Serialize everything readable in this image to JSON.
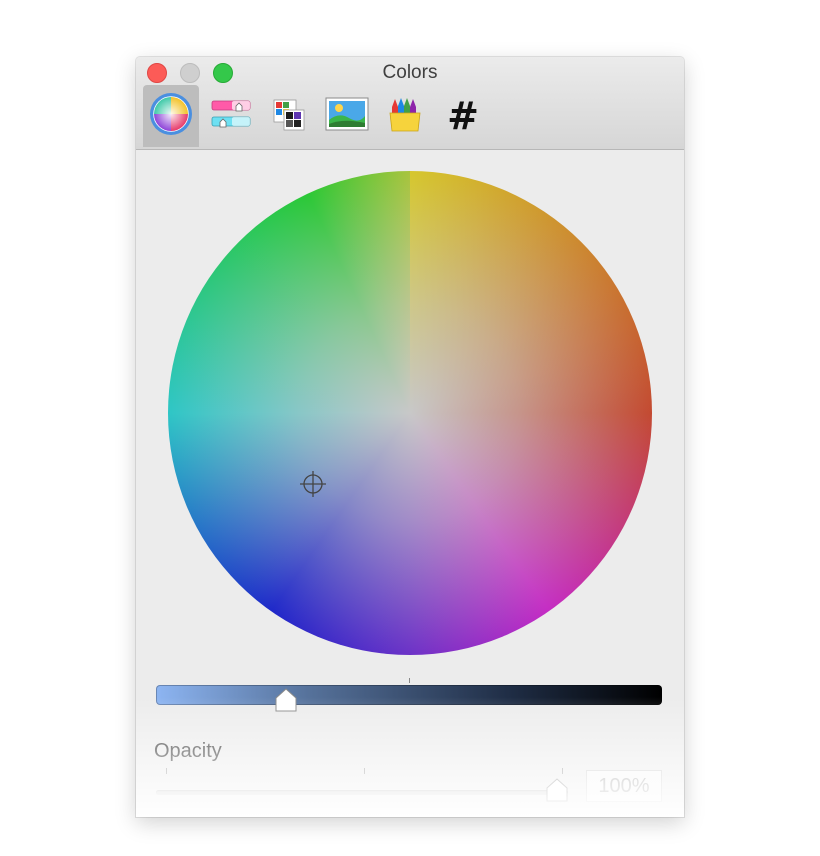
{
  "window": {
    "title": "Colors"
  },
  "toolbar": {
    "tabs": [
      {
        "name": "color-wheel",
        "selected": true
      },
      {
        "name": "color-sliders",
        "selected": false
      },
      {
        "name": "color-palettes",
        "selected": false
      },
      {
        "name": "image-palettes",
        "selected": false
      },
      {
        "name": "pencils",
        "selected": false
      },
      {
        "name": "hex",
        "label": "#",
        "selected": false
      }
    ]
  },
  "brightness": {
    "level": 0.245
  },
  "opacity": {
    "label": "Opacity",
    "value_text": "100%",
    "level": 1.0
  },
  "colors": {
    "close": "#fc5b57",
    "minimize": "#cfcfcf",
    "zoom": "#34c84a"
  }
}
